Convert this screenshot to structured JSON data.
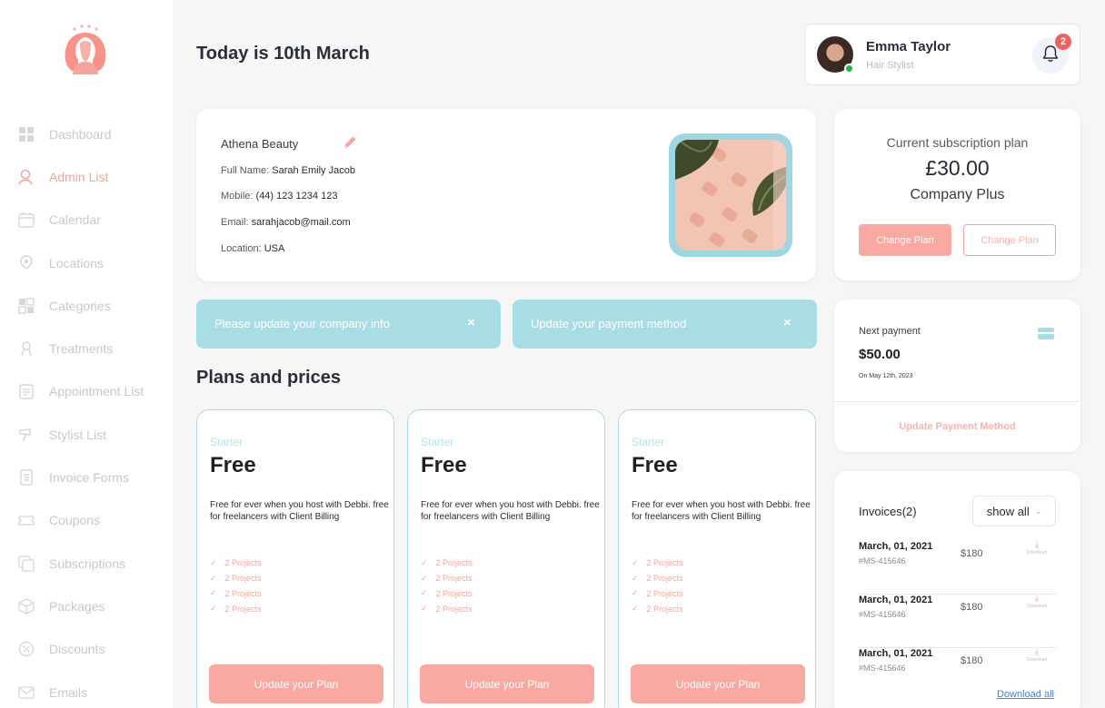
{
  "colors": {
    "accent": "#f6a39b",
    "teal": "#a8dde6",
    "online": "#23b14d",
    "badge": "#f06060"
  },
  "sidebar": {
    "items": [
      {
        "label": "Dashboard",
        "icon": "grid-icon",
        "active": false
      },
      {
        "label": "Admin List",
        "icon": "admin-icon",
        "active": true
      },
      {
        "label": "Calendar",
        "icon": "calendar-icon",
        "active": false
      },
      {
        "label": "Locations",
        "icon": "location-pin-icon",
        "active": false
      },
      {
        "label": "Categories",
        "icon": "categories-icon",
        "active": false
      },
      {
        "label": "Treatments",
        "icon": "treatment-icon",
        "active": false
      },
      {
        "label": "Appointment List",
        "icon": "clipboard-icon",
        "active": false
      },
      {
        "label": "Stylist List",
        "icon": "hair-dryer-icon",
        "active": false
      },
      {
        "label": "Invoice Forms",
        "icon": "invoice-icon",
        "active": false
      },
      {
        "label": "Coupons",
        "icon": "ticket-icon",
        "active": false
      },
      {
        "label": "Subscriptions",
        "icon": "subscriptions-icon",
        "active": false
      },
      {
        "label": "Packages",
        "icon": "package-icon",
        "active": false
      },
      {
        "label": "Discounts",
        "icon": "discount-icon",
        "active": false
      },
      {
        "label": "Emails",
        "icon": "mail-icon",
        "active": false
      }
    ]
  },
  "header": {
    "title": "Today is 10th March",
    "user": {
      "name": "Emma Taylor",
      "role": "Hair Stylist"
    },
    "notifications": "2"
  },
  "company": {
    "name": "Athena Beauty",
    "fields": [
      {
        "label": "Full Name:",
        "value": "Sarah Emily Jacob"
      },
      {
        "label": "Mobile:",
        "value": "(44) 123 1234 123"
      },
      {
        "label": "Email:",
        "value": "sarahjacob@mail.com"
      },
      {
        "label": "Location:",
        "value": "USA"
      }
    ]
  },
  "alerts": [
    {
      "text": "Please update your company info",
      "close": "×"
    },
    {
      "text": "Update your payment method",
      "close": "×"
    }
  ],
  "plans_section": {
    "title": "Plans and prices",
    "plans": [
      {
        "tier": "Starter",
        "price": "Free",
        "description": "Free for ever when you host with Debbi. free for freelancers with Client Billing",
        "features": [
          "2 Projects",
          "2 Projects",
          "2 Projects",
          "2 Projects"
        ],
        "button": "Update your Plan"
      },
      {
        "tier": "Starter",
        "price": "Free",
        "description": "Free for ever when you host with Debbi. free for freelancers with Client Billing",
        "features": [
          "2 Projects",
          "2 Projects",
          "2 Projects",
          "2 Projects"
        ],
        "button": "Update your Plan"
      },
      {
        "tier": "Starter",
        "price": "Free",
        "description": "Free for ever when you host with Debbi. free for freelancers with Client Billing",
        "features": [
          "2 Projects",
          "2 Projects",
          "2 Projects",
          "2 Projects"
        ],
        "button": "Update your Plan"
      }
    ]
  },
  "subscription": {
    "label": "Current subscription plan",
    "price": "£30.00",
    "plan_name": "Company Plus",
    "primary_button": "Change Plan",
    "secondary_button": "Change Plan"
  },
  "payment": {
    "label": "Next payment",
    "amount": "$50.00",
    "date": "On May 12th, 2023",
    "link": "Update Payment Method"
  },
  "invoices": {
    "title": "Invoices(2)",
    "filter": "show all",
    "rows": [
      {
        "date": "March, 01, 2021",
        "id": "#MS-415646",
        "amount": "$180",
        "download": "Download"
      },
      {
        "date": "March, 01, 2021",
        "id": "#MS-415646",
        "amount": "$180",
        "download": "Download"
      },
      {
        "date": "March, 01, 2021",
        "id": "#MS-415646",
        "amount": "$180",
        "download": "Download"
      }
    ],
    "download_all": "Download all"
  }
}
